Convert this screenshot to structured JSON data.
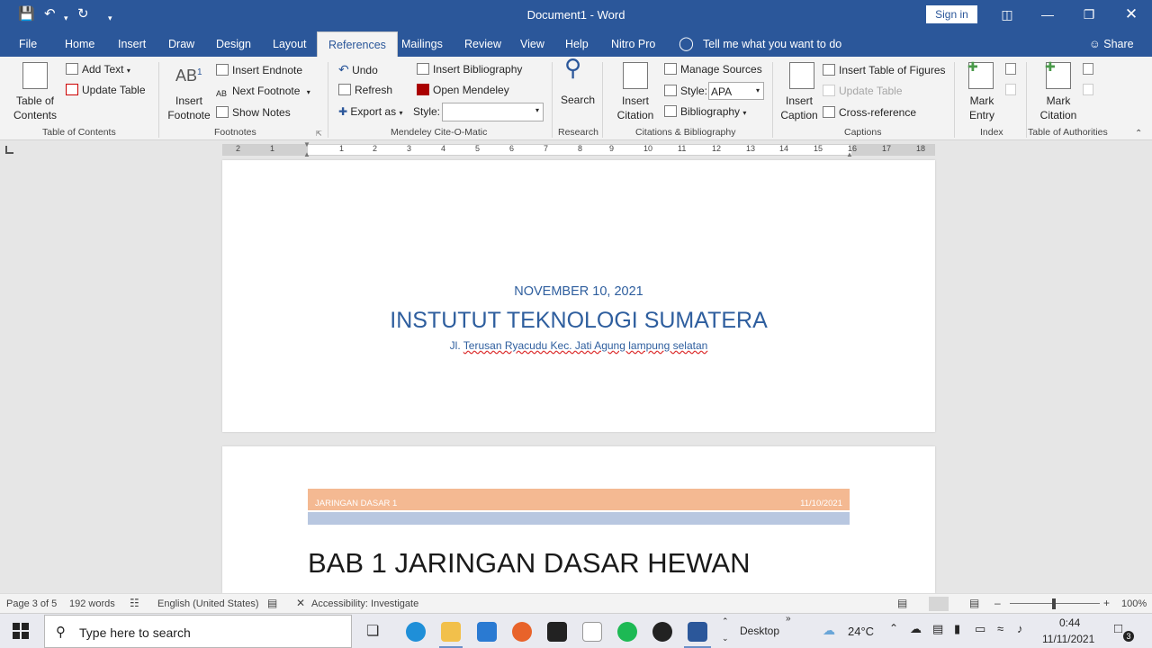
{
  "window": {
    "title": "Document1  -  Word",
    "sign_in": "Sign in",
    "share": "Share"
  },
  "tabs": [
    "File",
    "Home",
    "Insert",
    "Draw",
    "Design",
    "Layout",
    "References",
    "Mailings",
    "Review",
    "View",
    "Help",
    "Nitro Pro"
  ],
  "active_tab": "References",
  "tell_me": "Tell me what you want to do",
  "ribbon": {
    "toc": {
      "big": "Table of Contents",
      "add_text": "Add Text",
      "update_table": "Update Table",
      "label": "Table of Contents"
    },
    "footnotes": {
      "big": "Insert Footnote",
      "insert_endnote": "Insert Endnote",
      "next_footnote": "Next Footnote",
      "show_notes": "Show Notes",
      "label": "Footnotes"
    },
    "mendeley": {
      "undo": "Undo",
      "refresh": "Refresh",
      "export_as": "Export as",
      "insert_bibliography": "Insert Bibliography",
      "open_mendeley": "Open Mendeley",
      "style_label": "Style:",
      "label": "Mendeley Cite-O-Matic"
    },
    "research": {
      "big": "Search",
      "label": "Research"
    },
    "citations": {
      "big": "Insert Citation",
      "manage_sources": "Manage Sources",
      "style_label": "Style:",
      "style_value": "APA",
      "bibliography": "Bibliography",
      "label": "Citations & Bibliography"
    },
    "captions": {
      "big": "Insert Caption",
      "insert_table_of_figures": "Insert Table of Figures",
      "update_table": "Update Table",
      "cross_reference": "Cross-reference",
      "label": "Captions"
    },
    "index": {
      "big": "Mark Entry",
      "label": "Index"
    },
    "authorities": {
      "big": "Mark Citation",
      "label": "Table of Authorities"
    }
  },
  "ruler": [
    "2",
    "1",
    "1",
    "2",
    "3",
    "4",
    "5",
    "6",
    "7",
    "8",
    "9",
    "10",
    "11",
    "12",
    "13",
    "14",
    "15",
    "16",
    "17",
    "18"
  ],
  "document": {
    "page1": {
      "date": "NOVEMBER 10, 2021",
      "title": "INSTUTUT TEKNOLOGI SUMATERA",
      "address_prefix": "Jl. ",
      "address_rest": "Terusan Ryacudu Kec. Jati Agung lampung selatan"
    },
    "page2": {
      "header_left": "JARINGAN DASAR 1",
      "header_right": "11/10/2021",
      "heading": "BAB 1 JARINGAN DASAR HEWAN"
    }
  },
  "status": {
    "page": "Page 3 of 5",
    "words": "192 words",
    "language": "English (United States)",
    "accessibility": "Accessibility: Investigate",
    "zoom": "100%"
  },
  "taskbar": {
    "search_placeholder": "Type here to search",
    "desktop": "Desktop",
    "weather": "24°C",
    "time": "0:44",
    "date": "11/11/2021",
    "notifications": "3"
  },
  "colors": {
    "word_blue": "#2b579a",
    "heading_blue": "#2e5e9e",
    "header_band": "#f4b992"
  }
}
